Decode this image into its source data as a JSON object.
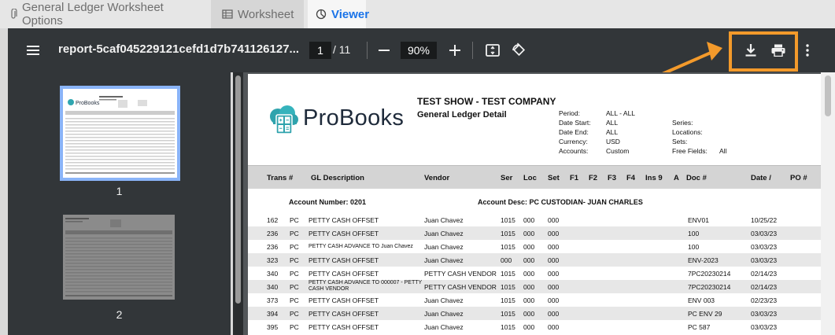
{
  "tabs": [
    {
      "label": "General Ledger Worksheet Options",
      "icon": "paperclip-icon"
    },
    {
      "label": "Worksheet",
      "icon": "table-icon"
    },
    {
      "label": "Viewer",
      "icon": "pie-chart-icon"
    }
  ],
  "toolbar": {
    "menu_icon": "hamburger-menu-icon",
    "file_name": "report-5caf045229121cefd1d7b741126127...",
    "current_page": "1",
    "total_pages": "/ 11",
    "zoom": "90%",
    "icons": [
      "zoom-out-icon",
      "zoom-in-icon",
      "fit-page-icon",
      "rotate-icon",
      "download-icon",
      "print-icon",
      "more-options-icon"
    ]
  },
  "annotation": {
    "color": "#f39a2b"
  },
  "thumbnails": [
    {
      "label": "1",
      "selected": true
    },
    {
      "label": "2",
      "selected": false
    }
  ],
  "report": {
    "brand": "ProBooks",
    "company": "TEST SHOW - TEST COMPANY",
    "title": "General Ledger Detail",
    "meta": {
      "period_label": "Period:",
      "period_value": "ALL - ALL",
      "date_start_label": "Date Start:",
      "date_start_value": "ALL",
      "date_end_label": "Date End:",
      "date_end_value": "ALL",
      "currency_label": "Currency:",
      "currency_value": "USD",
      "accounts_label": "Accounts:",
      "accounts_value": "Custom",
      "series_label": "Series:",
      "locations_label": "Locations:",
      "sets_label": "Sets:",
      "free_fields_label": "Free Fields:",
      "free_fields_value": "All"
    },
    "columns": [
      "Trans #",
      "GL Description",
      "Vendor",
      "Ser",
      "Loc",
      "Set",
      "F1",
      "F2",
      "F3",
      "F4",
      "Ins 9",
      "A",
      "Doc #",
      "Date /",
      "PO #"
    ],
    "account_number": "Account Number:  0201",
    "account_desc": "Account Desc:  PC CUSTODIAN- JUAN CHARLES",
    "rows": [
      {
        "trans": "162",
        "type": "PC",
        "desc": "PETTY CASH OFFSET",
        "vendor": "Juan Chavez",
        "ser": "1015",
        "loc": "000",
        "set": "000",
        "doc": "ENV01",
        "date": "10/25/22"
      },
      {
        "trans": "236",
        "type": "PC",
        "desc": "PETTY CASH OFFSET",
        "vendor": "Juan Chavez",
        "ser": "1015",
        "loc": "000",
        "set": "000",
        "doc": "100",
        "date": "03/03/23"
      },
      {
        "trans": "236",
        "type": "PC",
        "desc": "PETTY CASH ADVANCE TO Juan Chavez",
        "vendor": "Juan Chavez",
        "ser": "1015",
        "loc": "000",
        "set": "000",
        "doc": "100",
        "date": "03/03/23"
      },
      {
        "trans": "323",
        "type": "PC",
        "desc": "PETTY CASH OFFSET",
        "vendor": "Juan Chavez",
        "ser": "000",
        "loc": "000",
        "set": "000",
        "doc": "ENV-2023",
        "date": "03/03/23"
      },
      {
        "trans": "340",
        "type": "PC",
        "desc": "PETTY CASH OFFSET",
        "vendor": "PETTY CASH VENDOR",
        "ser": "1015",
        "loc": "000",
        "set": "000",
        "doc": "7PC20230214",
        "date": "02/14/23"
      },
      {
        "trans": "340",
        "type": "PC",
        "desc": "PETTY CASH ADVANCE TO 000007 - PETTY CASH VENDOR",
        "vendor": "PETTY CASH VENDOR",
        "ser": "1015",
        "loc": "000",
        "set": "000",
        "doc": "7PC20230214",
        "date": "02/14/23"
      },
      {
        "trans": "373",
        "type": "PC",
        "desc": "PETTY CASH OFFSET",
        "vendor": "Juan Chavez",
        "ser": "1015",
        "loc": "000",
        "set": "000",
        "doc": "ENV 003",
        "date": "02/23/23"
      },
      {
        "trans": "394",
        "type": "PC",
        "desc": "PETTY CASH OFFSET",
        "vendor": "Juan Chavez",
        "ser": "1015",
        "loc": "000",
        "set": "000",
        "doc": "PC ENV 29",
        "date": "03/03/23"
      },
      {
        "trans": "395",
        "type": "PC",
        "desc": "PETTY CASH OFFSET",
        "vendor": "Juan Chavez",
        "ser": "1015",
        "loc": "000",
        "set": "000",
        "doc": "PC 587",
        "date": "03/03/23"
      }
    ]
  }
}
